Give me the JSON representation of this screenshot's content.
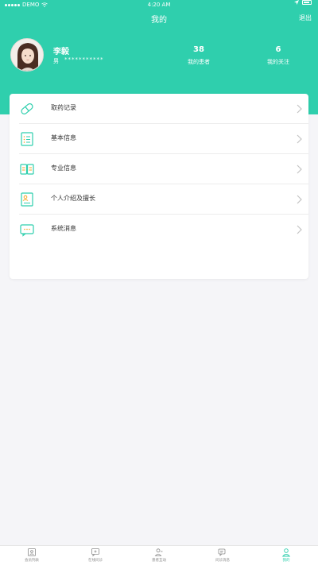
{
  "statusbar": {
    "carrier": "DEMO",
    "time": "4:20 AM"
  },
  "navbar": {
    "title": "我的",
    "logout": "退出"
  },
  "profile": {
    "name": "李毅",
    "gender": "男",
    "phone": "***********",
    "stats": [
      {
        "value": "38",
        "label": "我的患者"
      },
      {
        "value": "6",
        "label": "我的关注"
      }
    ]
  },
  "menu": [
    {
      "label": "取药记录",
      "icon": "pill-icon"
    },
    {
      "label": "基本信息",
      "icon": "list-icon"
    },
    {
      "label": "专业信息",
      "icon": "book-icon"
    },
    {
      "label": "个人介绍及擅长",
      "icon": "profile-document-icon"
    },
    {
      "label": "系统消息",
      "icon": "message-icon"
    }
  ],
  "tabs": [
    {
      "label": "会员列表",
      "icon": "member-list-icon",
      "active": false
    },
    {
      "label": "在线问诊",
      "icon": "chat-consult-icon",
      "active": false
    },
    {
      "label": "患者互动",
      "icon": "patient-interaction-icon",
      "active": false
    },
    {
      "label": "问诊消息",
      "icon": "message-bubbles-icon",
      "active": false
    },
    {
      "label": "我的",
      "icon": "user-icon",
      "active": true
    }
  ],
  "colors": {
    "accent": "#2fcfad",
    "background": "#f5f5f8"
  }
}
